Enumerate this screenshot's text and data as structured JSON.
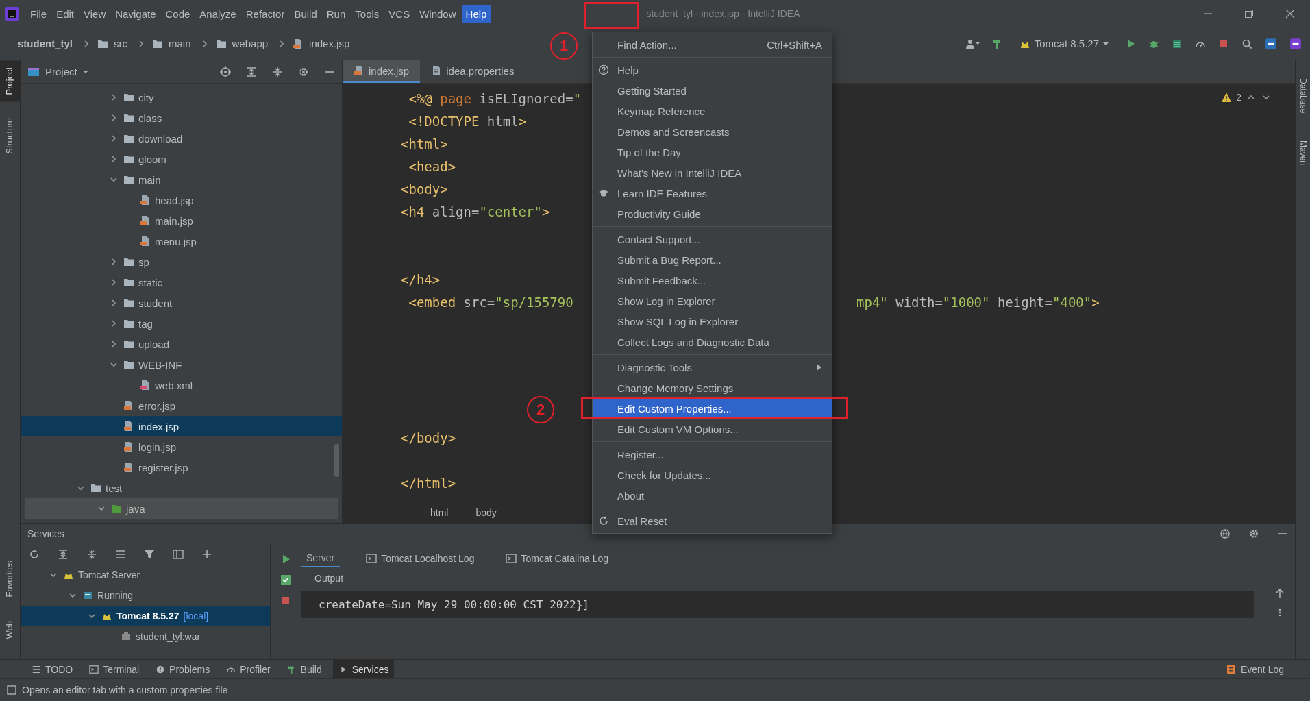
{
  "window": {
    "title": "student_tyl - index.jsp - IntelliJ IDEA"
  },
  "menu_bar": [
    {
      "label": "File",
      "selected": false
    },
    {
      "label": "Edit",
      "selected": false
    },
    {
      "label": "View",
      "selected": false
    },
    {
      "label": "Navigate",
      "selected": false
    },
    {
      "label": "Code",
      "selected": false
    },
    {
      "label": "Analyze",
      "selected": false
    },
    {
      "label": "Refactor",
      "selected": false
    },
    {
      "label": "Build",
      "selected": false
    },
    {
      "label": "Run",
      "selected": false
    },
    {
      "label": "Tools",
      "selected": false
    },
    {
      "label": "VCS",
      "selected": false
    },
    {
      "label": "Window",
      "selected": false
    },
    {
      "label": "Help",
      "selected": true
    }
  ],
  "breadcrumbs": [
    {
      "label": "student_tyl",
      "kind": "project"
    },
    {
      "label": "src",
      "kind": "folder"
    },
    {
      "label": "main",
      "kind": "folder"
    },
    {
      "label": "webapp",
      "kind": "folder"
    },
    {
      "label": "index.jsp",
      "kind": "file"
    }
  ],
  "run_config": {
    "label": "Tomcat 8.5.27"
  },
  "left_stripe": {
    "top": [
      {
        "label": "Project",
        "selected": true
      },
      {
        "label": "Structure",
        "selected": false
      }
    ],
    "bottom": [
      {
        "label": "Favorites",
        "selected": false
      },
      {
        "label": "Web",
        "selected": false
      }
    ]
  },
  "right_stripe": [
    "Database",
    "Maven"
  ],
  "project": {
    "title": "Project",
    "tree": [
      {
        "children": [
          {
            "children": [
              {
                "label": "city",
                "kind": "folder",
                "expanded": false,
                "selected": false
              },
              {
                "label": "class",
                "kind": "folder",
                "expanded": false,
                "selected": false
              },
              {
                "label": "download",
                "kind": "folder",
                "expanded": false,
                "selected": false
              },
              {
                "label": "gloom",
                "kind": "folder",
                "expanded": false,
                "selected": false
              },
              {
                "label": "main",
                "kind": "folder",
                "expanded": true,
                "selected": false,
                "children": [
                  {
                    "label": "head.jsp",
                    "kind": "jsp",
                    "selected": false
                  },
                  {
                    "label": "main.jsp",
                    "kind": "jsp",
                    "selected": false
                  },
                  {
                    "label": "menu.jsp",
                    "kind": "jsp",
                    "selected": false
                  }
                ]
              },
              {
                "label": "sp",
                "kind": "folder",
                "expanded": false,
                "selected": false
              },
              {
                "label": "static",
                "kind": "folder",
                "expanded": false,
                "selected": false
              },
              {
                "label": "student",
                "kind": "folder",
                "expanded": false,
                "selected": false
              },
              {
                "label": "tag",
                "kind": "folder",
                "expanded": false,
                "selected": false
              },
              {
                "label": "upload",
                "kind": "folder",
                "expanded": false,
                "selected": false
              },
              {
                "label": "WEB-INF",
                "kind": "folder",
                "expanded": true,
                "selected": false,
                "children": [
                  {
                    "label": "web.xml",
                    "kind": "xml",
                    "selected": false
                  }
                ]
              },
              {
                "label": "error.jsp",
                "kind": "jsp",
                "selected": false
              },
              {
                "label": "index.jsp",
                "kind": "jsp",
                "selected": true
              },
              {
                "label": "login.jsp",
                "kind": "jsp",
                "selected": false
              },
              {
                "label": "register.jsp",
                "kind": "jsp",
                "selected": false
              }
            ]
          }
        ]
      },
      {
        "label": "test",
        "kind": "folder",
        "expanded": true,
        "selected": false,
        "children": [
          {
            "label": "java",
            "kind": "source_folder",
            "expanded": true,
            "selected": false,
            "hovered": true
          }
        ]
      }
    ]
  },
  "editor": {
    "tabs": [
      {
        "label": "index.jsp",
        "kind": "jsp",
        "selected": true
      },
      {
        "label": "idea.properties",
        "kind": "properties",
        "selected": false
      }
    ],
    "warnings": "2",
    "lines": [
      {
        "kind": "code",
        "segments": [
          {
            "kind": "tag",
            "text": " <%@"
          },
          {
            "kind": "keyword",
            "text": " page"
          },
          {
            "kind": "attr",
            "text": " isELIgnored="
          },
          {
            "kind": "value",
            "text": "\""
          }
        ]
      },
      {
        "kind": "code",
        "segments": [
          {
            "kind": "tag",
            "text": " <!DOCTYPE"
          },
          {
            "kind": "attr",
            "text": " html"
          },
          {
            "kind": "tag",
            "text": ">"
          }
        ]
      },
      {
        "kind": "code",
        "segments": [
          {
            "kind": "tag",
            "text": "<html>"
          }
        ]
      },
      {
        "kind": "code",
        "segments": [
          {
            "kind": "tag",
            "text": " <head>"
          }
        ]
      },
      {
        "kind": "code",
        "segments": [
          {
            "kind": "tag",
            "text": "<body>"
          }
        ]
      },
      {
        "kind": "code",
        "segments": [
          {
            "kind": "tag",
            "text": "<h4"
          },
          {
            "kind": "attr",
            "text": " align="
          },
          {
            "kind": "value",
            "text": "\"center\""
          },
          {
            "kind": "tag",
            "text": ">"
          }
        ]
      },
      {
        "kind": "blank"
      },
      {
        "kind": "blank"
      },
      {
        "kind": "code",
        "segments": [
          {
            "kind": "tag",
            "text": "</h4>"
          }
        ]
      },
      {
        "kind": "code",
        "segments": [
          {
            "kind": "tag",
            "text": " <embed"
          },
          {
            "kind": "attr",
            "text": " src="
          },
          {
            "kind": "value",
            "text": "\"sp/155790"
          }
        ],
        "tail": [
          {
            "kind": "value",
            "text": "mp4\""
          },
          {
            "kind": "attr",
            "text": " width="
          },
          {
            "kind": "value",
            "text": "\"1000\""
          },
          {
            "kind": "attr",
            "text": " height="
          },
          {
            "kind": "value",
            "text": "\"400\""
          },
          {
            "kind": "tag",
            "text": ">"
          }
        ]
      },
      {
        "kind": "blank"
      },
      {
        "kind": "blank"
      },
      {
        "kind": "blank"
      },
      {
        "kind": "blank"
      },
      {
        "kind": "blank"
      },
      {
        "kind": "code",
        "segments": [
          {
            "kind": "tag",
            "text": "</body>"
          }
        ]
      },
      {
        "kind": "blank"
      },
      {
        "kind": "code",
        "segments": [
          {
            "kind": "tag",
            "text": "</html>"
          }
        ]
      }
    ],
    "breadcrumb": [
      "html",
      "body"
    ]
  },
  "help_menu": {
    "groups": [
      [
        {
          "label": "Find Action...",
          "shortcut": "Ctrl+Shift+A",
          "kind": "item",
          "selected": false
        }
      ],
      [
        {
          "label": "Help",
          "kind": "item",
          "selected": false
        },
        {
          "label": "Getting Started",
          "kind": "item",
          "selected": false
        },
        {
          "label": "Keymap Reference",
          "kind": "item",
          "selected": false
        },
        {
          "label": "Demos and Screencasts",
          "kind": "item",
          "selected": false
        },
        {
          "label": "Tip of the Day",
          "kind": "item",
          "selected": false
        },
        {
          "label": "What's New in IntelliJ IDEA",
          "kind": "item",
          "selected": false
        },
        {
          "label": "Learn IDE Features",
          "kind": "item",
          "selected": false
        },
        {
          "label": "Productivity Guide",
          "kind": "item",
          "selected": false
        }
      ],
      [
        {
          "label": "Contact Support...",
          "kind": "item",
          "selected": false
        },
        {
          "label": "Submit a Bug Report...",
          "kind": "item",
          "selected": false
        },
        {
          "label": "Submit Feedback...",
          "kind": "item",
          "selected": false
        },
        {
          "label": "Show Log in Explorer",
          "kind": "item",
          "selected": false
        },
        {
          "label": "Show SQL Log in Explorer",
          "kind": "item",
          "selected": false
        },
        {
          "label": "Collect Logs and Diagnostic Data",
          "kind": "item",
          "selected": false
        }
      ],
      [
        {
          "label": "Diagnostic Tools",
          "kind": "submenu",
          "selected": false
        },
        {
          "label": "Change Memory Settings",
          "kind": "item",
          "selected": false
        },
        {
          "label": "Edit Custom Properties...",
          "kind": "item",
          "selected": true
        },
        {
          "label": "Edit Custom VM Options...",
          "kind": "item",
          "selected": false
        }
      ],
      [
        {
          "label": "Register...",
          "kind": "item",
          "selected": false
        },
        {
          "label": "Check for Updates...",
          "kind": "item",
          "selected": false
        },
        {
          "label": "About",
          "kind": "item",
          "selected": false
        }
      ],
      [
        {
          "label": "Eval Reset",
          "kind": "item",
          "selected": false
        }
      ]
    ]
  },
  "services": {
    "title": "Services",
    "tree": [
      {
        "label": "Tomcat Server",
        "expanded": true,
        "selected": false,
        "children": [
          {
            "label": "Running",
            "expanded": true,
            "selected": false,
            "children": [
              {
                "label": "Tomcat 8.5.27",
                "note": "[local]",
                "expanded": true,
                "selected": true,
                "children": [
                  {
                    "label": "student_tyl:war",
                    "selected": false
                  }
                ]
              }
            ]
          }
        ]
      }
    ],
    "tabs": [
      {
        "label": "Server",
        "selected": true
      },
      {
        "label": "Tomcat Localhost Log",
        "selected": false
      },
      {
        "label": "Tomcat Catalina Log",
        "selected": false
      }
    ],
    "output_label": "Output",
    "console": "createDate=Sun May 29 00:00:00 CST 2022}]"
  },
  "tool_tabs": [
    {
      "label": "TODO",
      "selected": false
    },
    {
      "label": "Terminal",
      "selected": false
    },
    {
      "label": "Problems",
      "selected": false
    },
    {
      "label": "Profiler",
      "selected": false
    },
    {
      "label": "Build",
      "selected": false
    },
    {
      "label": "Services",
      "selected": true
    }
  ],
  "event_log": "Event Log",
  "status": "Opens an editor tab with a custom properties file",
  "annotations": [
    {
      "label": "1"
    },
    {
      "label": "2"
    }
  ]
}
